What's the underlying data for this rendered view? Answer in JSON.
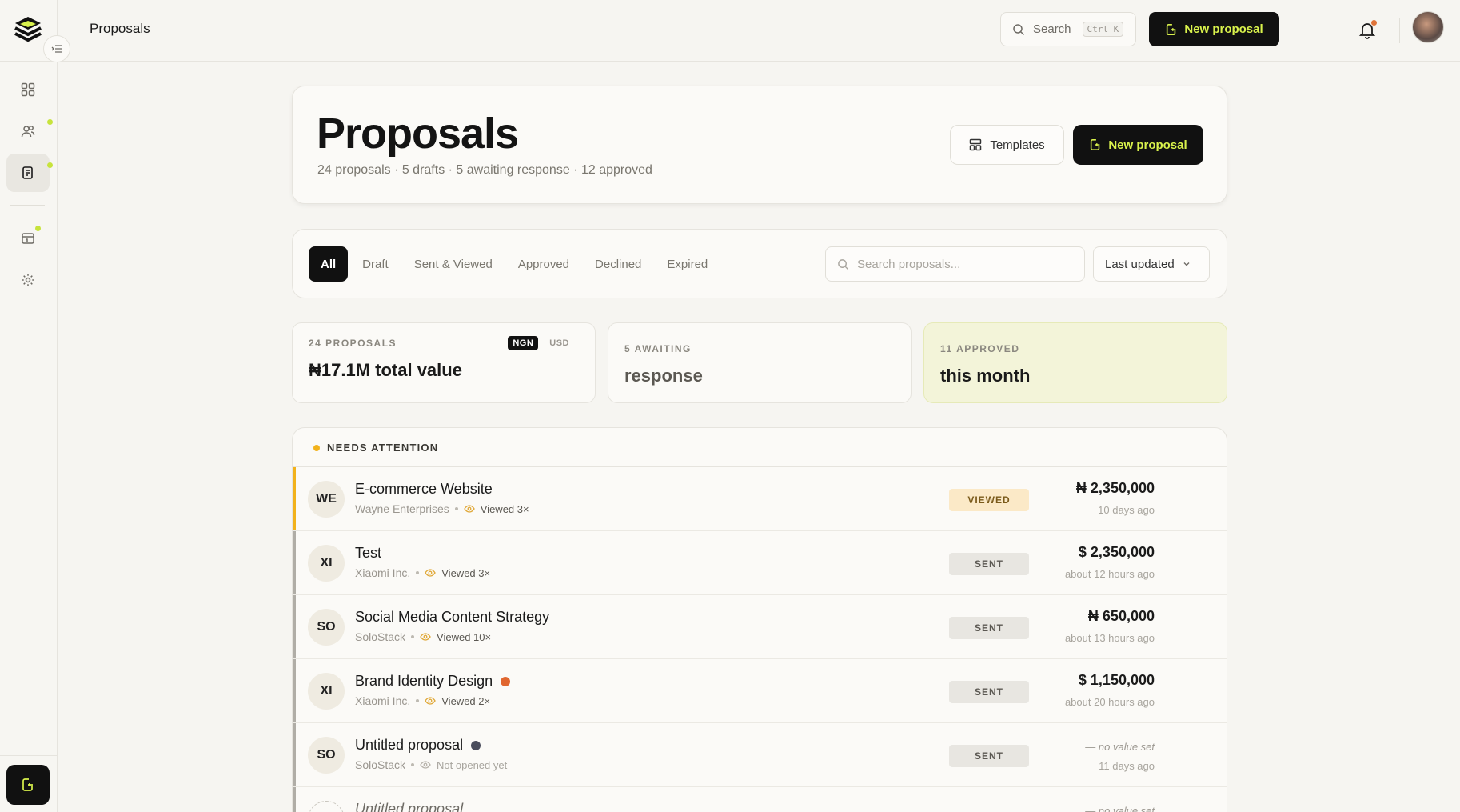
{
  "topbar": {
    "title": "Proposals",
    "search_label": "Search",
    "search_shortcut": "Ctrl K",
    "new_label": "New proposal"
  },
  "header": {
    "title": "Proposals",
    "subtitle": "24 proposals · 5 drafts · 5 awaiting response · 12 approved",
    "templates_label": "Templates",
    "new_label": "New proposal"
  },
  "filters": {
    "tabs": [
      "All",
      "Draft",
      "Sent & Viewed",
      "Approved",
      "Declined",
      "Expired"
    ],
    "active_tab": "All",
    "search_placeholder": "Search proposals...",
    "sort_label": "Last updated"
  },
  "stats": [
    {
      "label": "24 PROPOSALS",
      "value": "₦17.1M total value",
      "currencies": [
        "NGN",
        "USD"
      ],
      "active_currency": "NGN"
    },
    {
      "label": "5 AWAITING",
      "value": "response"
    },
    {
      "label": "11 APPROVED",
      "value": "this month"
    }
  ],
  "attention": {
    "label": "NEEDS ATTENTION",
    "rows": [
      {
        "initials": "WE",
        "title": "E-commerce Website",
        "client": "Wayne Enterprises",
        "views": "Viewed 3×",
        "status": "VIEWED",
        "amount": "₦ 2,350,000",
        "when": "10 days ago",
        "dot": ""
      },
      {
        "initials": "XI",
        "title": "Test",
        "client": "Xiaomi Inc.",
        "views": "Viewed 3×",
        "status": "SENT",
        "amount": "$ 2,350,000",
        "when": "about 12 hours ago",
        "dot": ""
      },
      {
        "initials": "SO",
        "title": "Social Media Content Strategy",
        "client": "SoloStack",
        "views": "Viewed 10×",
        "status": "SENT",
        "amount": "₦ 650,000",
        "when": "about 13 hours ago",
        "dot": ""
      },
      {
        "initials": "XI",
        "title": "Brand Identity Design",
        "client": "Xiaomi Inc.",
        "views": "Viewed 2×",
        "status": "SENT",
        "amount": "$ 1,150,000",
        "when": "about 20 hours ago",
        "dot": "#e0662f"
      },
      {
        "initials": "SO",
        "title": "Untitled proposal",
        "client": "SoloStack",
        "views": "Not opened yet",
        "status": "SENT",
        "amount": "— no value set",
        "when": "11 days ago",
        "dot": "#4a4d5c"
      },
      {
        "initials": "",
        "title": "Untitled proposal",
        "client": "",
        "views": "",
        "status": "",
        "amount": "— no value set",
        "when": "",
        "dot": ""
      }
    ]
  },
  "colors": {
    "accent": "#d9f24c",
    "dark": "#111111",
    "warning": "#f2b21b",
    "background": "#f6f5f1"
  }
}
